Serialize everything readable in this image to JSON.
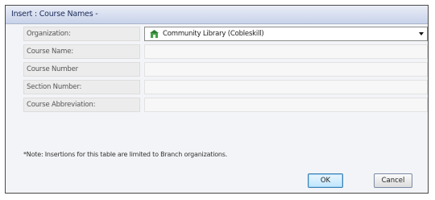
{
  "dialog": {
    "title": "Insert : Course Names -"
  },
  "form": {
    "organization": {
      "label": "Organization:",
      "selected_value": "Community Library (Cobleskill)",
      "icon": "building-icon"
    },
    "fields": [
      {
        "label": "Course Name:",
        "value": ""
      },
      {
        "label": "Course Number",
        "value": ""
      },
      {
        "label": "Section Number:",
        "value": ""
      },
      {
        "label": "Course Abbreviation:",
        "value": ""
      }
    ]
  },
  "note": "*Note: Insertions for this table are limited to Branch organizations.",
  "buttons": {
    "ok_label": "OK",
    "cancel_label": "Cancel"
  },
  "colors": {
    "title_text": "#1a2a5a",
    "ok_border": "#3c7fb1",
    "org_icon": "#2e7d32"
  }
}
